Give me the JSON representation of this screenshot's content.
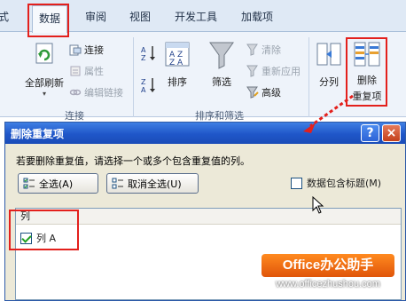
{
  "ribbon": {
    "tabs": [
      {
        "label": "式"
      },
      {
        "label": "数据"
      },
      {
        "label": "审阅"
      },
      {
        "label": "视图"
      },
      {
        "label": "开发工具"
      },
      {
        "label": "加载项"
      }
    ],
    "connections_group": {
      "label": "连接",
      "refresh_all": "全部刷新",
      "connections": "连接",
      "properties": "属性",
      "edit_links": "编辑链接"
    },
    "sort_filter_group": {
      "label": "排序和筛选",
      "sort": "排序",
      "filter": "筛选",
      "clear": "清除",
      "reapply": "重新应用",
      "advanced": "高级"
    },
    "data_tools": {
      "text_to_columns": "分列",
      "remove_duplicates_line1": "删除",
      "remove_duplicates_line2": "重复项"
    }
  },
  "dialog": {
    "title": "删除重复项",
    "help": "?",
    "close": "×",
    "instruction": "若要删除重复值，请选择一个或多个包含重复值的列。",
    "select_all": "全选(A)",
    "unselect_all": "取消全选(U)",
    "header_checkbox": "数据包含标题(M)",
    "header_checked": false,
    "list_header": "列",
    "columns": [
      {
        "label": "列 A",
        "checked": true
      }
    ]
  },
  "watermark": {
    "badge": "Office办公助手",
    "url": "www.officezhushou.com"
  },
  "colors": {
    "highlight": "#e3201c",
    "title_bar": "#1f56c9",
    "dialog_bg": "#ece9d8",
    "watermark": "#ff8a1f"
  }
}
